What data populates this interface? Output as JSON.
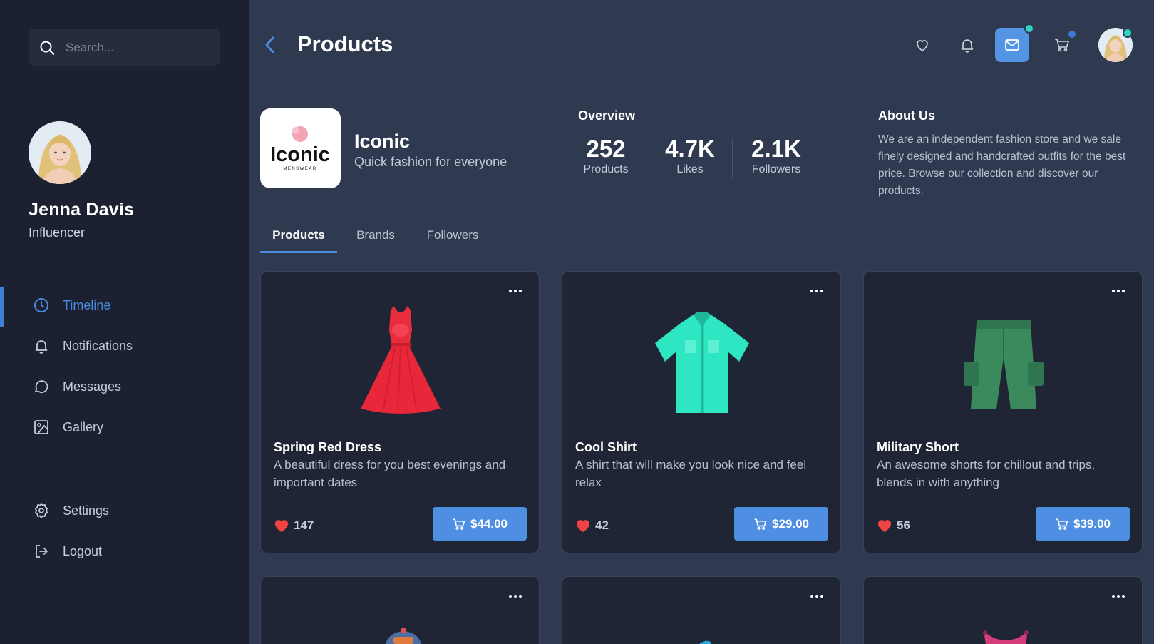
{
  "sidebar": {
    "search_placeholder": "Search...",
    "profile": {
      "name": "Jenna Davis",
      "role": "Influencer"
    },
    "nav": [
      {
        "label": "Timeline",
        "icon": "clock-icon",
        "active": true
      },
      {
        "label": "Notifications",
        "icon": "bell-icon"
      },
      {
        "label": "Messages",
        "icon": "chat-bubble-icon"
      },
      {
        "label": "Gallery",
        "icon": "image-icon"
      }
    ],
    "bottom_nav": [
      {
        "label": "Settings",
        "icon": "gear-icon"
      },
      {
        "label": "Logout",
        "icon": "logout-icon"
      }
    ]
  },
  "header": {
    "title": "Products",
    "icons": [
      "heart-icon",
      "bell-icon",
      "mail-icon",
      "cart-icon",
      "avatar"
    ]
  },
  "shop": {
    "logo_text": "Iconic",
    "logo_subtext": "MENSWEAR",
    "name": "Iconic",
    "tagline": "Quick fashion for everyone"
  },
  "overview": {
    "title": "Overview",
    "stats": [
      {
        "value": "252",
        "label": "Products"
      },
      {
        "value": "4.7K",
        "label": "Likes"
      },
      {
        "value": "2.1K",
        "label": "Followers"
      }
    ]
  },
  "about": {
    "title": "About Us",
    "text": "We are an independent fashion store and we sale finely designed and handcrafted outfits for the best price. Browse our collection and discover our products."
  },
  "tabs": [
    {
      "label": "Products",
      "active": true
    },
    {
      "label": "Brands"
    },
    {
      "label": "Followers"
    }
  ],
  "products": [
    {
      "name": "Spring Red Dress",
      "description": "A beautiful dress for you best evenings and important dates",
      "likes": "147",
      "price": "$44.00"
    },
    {
      "name": "Cool Shirt",
      "description": "A shirt that will make you look nice and feel relax",
      "likes": "42",
      "price": "$29.00"
    },
    {
      "name": "Military Short",
      "description": "An awesome shorts for chillout and trips, blends in with anything",
      "likes": "56",
      "price": "$39.00"
    }
  ],
  "colors": {
    "accent": "#4f8fe3",
    "sidebar_bg": "#1b2130",
    "main_bg": "#2f3a51",
    "card_bg": "#1f2535",
    "heart": "#ef4444",
    "online_dot": "#2dd4bf"
  }
}
